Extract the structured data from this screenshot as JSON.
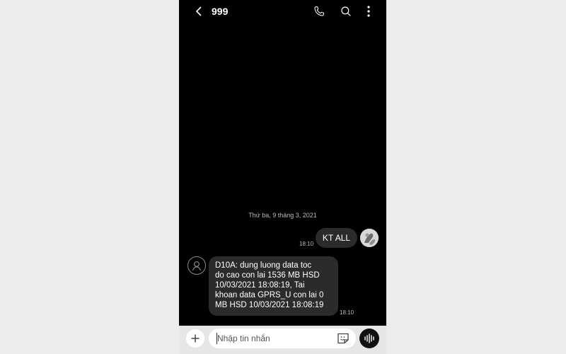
{
  "header": {
    "title": "999",
    "back_icon": "chevron-left-icon",
    "call_icon": "phone-icon",
    "search_icon": "search-icon",
    "more_icon": "more-vertical-icon"
  },
  "conversation": {
    "date_separator": "Thứ ba, 9 tháng 3, 2021",
    "messages": [
      {
        "direction": "sent",
        "text": "KT ALL",
        "time": "18:10"
      },
      {
        "direction": "received",
        "lines": [
          "D10A: dung luong data toc",
          "do cao con lai 1536 MB HSD",
          "10/03/2021 18:08:19, Tai",
          "khoan data GPRS_U con lai 0",
          "MB HSD 10/03/2021 18:08:19"
        ],
        "time": "18:10"
      }
    ]
  },
  "composer": {
    "placeholder": "Nhập tin nhắn",
    "value": "",
    "add_icon": "plus-icon",
    "sticker_icon": "sticker-icon",
    "voice_icon": "voice-waveform-icon"
  },
  "colors": {
    "background": "#000000",
    "bubble": "#2b2b2b",
    "text": "#ffffff",
    "composer_bar": "#e6e6e6"
  }
}
